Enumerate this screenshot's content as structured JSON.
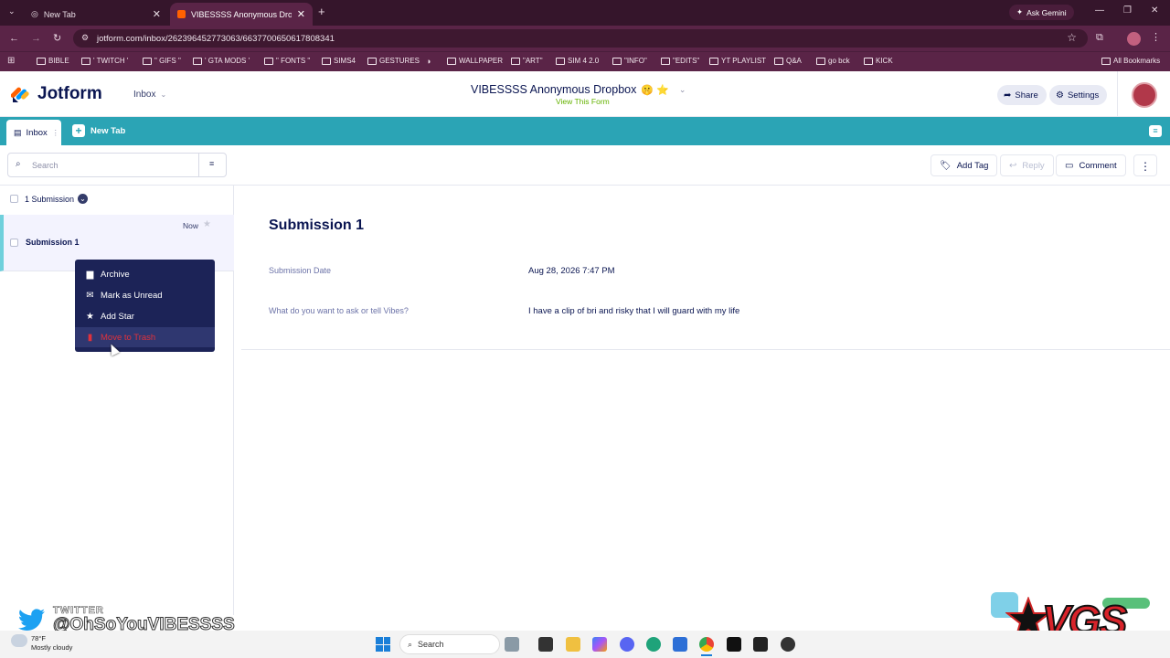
{
  "browser": {
    "tabs": [
      {
        "label": "New Tab",
        "close": "✕"
      },
      {
        "label": "VIBESSSS Anonymous Dropbox",
        "close": "✕"
      }
    ],
    "new_tab": "+",
    "ask_gemini": "Ask Gemini",
    "url": "jotform.com/inbox/262396452773063/6637700650617808341",
    "bookmarks": [
      "BIBLE",
      "' TWITCH '",
      "\" GIFS \"",
      "' GTA MODS '",
      "\" FONTS \"",
      "SIMS4",
      "GESTURES",
      "WALLPAPER",
      "\"ART\"",
      "SIM 4 2.0",
      "\"INFO\"",
      "\"EDITS\"",
      "YT PLAYLIST",
      "Q&A",
      "go bck",
      "KICK"
    ],
    "all_bookmarks": "All Bookmarks"
  },
  "jotform": {
    "logo": "Jotform",
    "inbox_dropdown": "Inbox",
    "form_title": "VIBESSSS Anonymous Dropbox",
    "form_emoji": "🤫 ⭐",
    "view_form": "View This Form",
    "share": "Share",
    "settings": "Settings",
    "tabs": {
      "inbox": "Inbox",
      "new_tab": "New Tab"
    },
    "search_placeholder": "Search",
    "actions": {
      "add_tag": "Add Tag",
      "reply": "Reply",
      "comment": "Comment"
    },
    "list": {
      "count_label": "1 Submission",
      "items": [
        {
          "title": "Submission 1",
          "time": "Now"
        }
      ]
    },
    "context_menu": [
      "Archive",
      "Mark as Unread",
      "Add Star",
      "Move to Trash"
    ],
    "detail": {
      "title": "Submission 1",
      "fields": [
        {
          "label": "Submission Date",
          "value": "Aug 28, 2026 7:47 PM"
        },
        {
          "label": "What do you want to ask or tell Vibes?",
          "value": "I have a clip of bri and risky that I will guard with my life"
        }
      ]
    }
  },
  "overlay": {
    "twitter_label": "TWITTER",
    "twitter_handle": "@OhSoYouVIBESSSS",
    "logo_text": "VGS"
  },
  "taskbar": {
    "weather_temp": "78°F",
    "weather_desc": "Mostly cloudy",
    "search": "Search"
  },
  "colors": {
    "chrome_dark": "#35152b",
    "chrome": "#5a2447",
    "teal": "#2ba4b5",
    "navy": "#0a1551",
    "menu": "#1c2357",
    "trash": "#e0323c"
  }
}
